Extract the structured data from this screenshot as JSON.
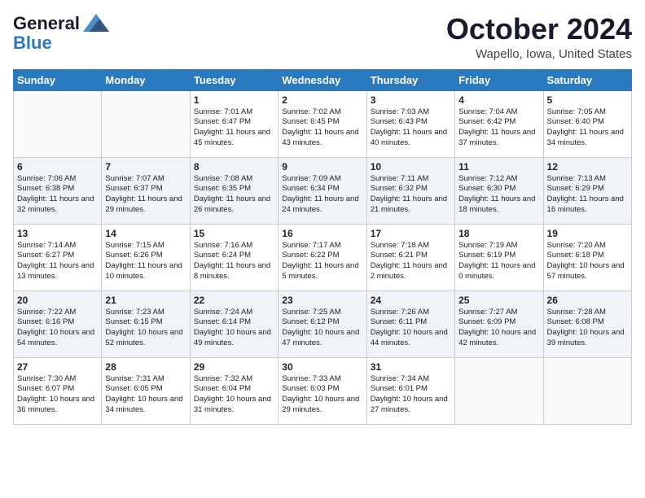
{
  "header": {
    "logo_general": "General",
    "logo_blue": "Blue",
    "month_title": "October 2024",
    "location": "Wapello, Iowa, United States"
  },
  "days_of_week": [
    "Sunday",
    "Monday",
    "Tuesday",
    "Wednesday",
    "Thursday",
    "Friday",
    "Saturday"
  ],
  "weeks": [
    [
      {
        "day": "",
        "info": ""
      },
      {
        "day": "",
        "info": ""
      },
      {
        "day": "1",
        "info": "Sunrise: 7:01 AM\nSunset: 6:47 PM\nDaylight: 11 hours and 45 minutes."
      },
      {
        "day": "2",
        "info": "Sunrise: 7:02 AM\nSunset: 6:45 PM\nDaylight: 11 hours and 43 minutes."
      },
      {
        "day": "3",
        "info": "Sunrise: 7:03 AM\nSunset: 6:43 PM\nDaylight: 11 hours and 40 minutes."
      },
      {
        "day": "4",
        "info": "Sunrise: 7:04 AM\nSunset: 6:42 PM\nDaylight: 11 hours and 37 minutes."
      },
      {
        "day": "5",
        "info": "Sunrise: 7:05 AM\nSunset: 6:40 PM\nDaylight: 11 hours and 34 minutes."
      }
    ],
    [
      {
        "day": "6",
        "info": "Sunrise: 7:06 AM\nSunset: 6:38 PM\nDaylight: 11 hours and 32 minutes."
      },
      {
        "day": "7",
        "info": "Sunrise: 7:07 AM\nSunset: 6:37 PM\nDaylight: 11 hours and 29 minutes."
      },
      {
        "day": "8",
        "info": "Sunrise: 7:08 AM\nSunset: 6:35 PM\nDaylight: 11 hours and 26 minutes."
      },
      {
        "day": "9",
        "info": "Sunrise: 7:09 AM\nSunset: 6:34 PM\nDaylight: 11 hours and 24 minutes."
      },
      {
        "day": "10",
        "info": "Sunrise: 7:11 AM\nSunset: 6:32 PM\nDaylight: 11 hours and 21 minutes."
      },
      {
        "day": "11",
        "info": "Sunrise: 7:12 AM\nSunset: 6:30 PM\nDaylight: 11 hours and 18 minutes."
      },
      {
        "day": "12",
        "info": "Sunrise: 7:13 AM\nSunset: 6:29 PM\nDaylight: 11 hours and 16 minutes."
      }
    ],
    [
      {
        "day": "13",
        "info": "Sunrise: 7:14 AM\nSunset: 6:27 PM\nDaylight: 11 hours and 13 minutes."
      },
      {
        "day": "14",
        "info": "Sunrise: 7:15 AM\nSunset: 6:26 PM\nDaylight: 11 hours and 10 minutes."
      },
      {
        "day": "15",
        "info": "Sunrise: 7:16 AM\nSunset: 6:24 PM\nDaylight: 11 hours and 8 minutes."
      },
      {
        "day": "16",
        "info": "Sunrise: 7:17 AM\nSunset: 6:22 PM\nDaylight: 11 hours and 5 minutes."
      },
      {
        "day": "17",
        "info": "Sunrise: 7:18 AM\nSunset: 6:21 PM\nDaylight: 11 hours and 2 minutes."
      },
      {
        "day": "18",
        "info": "Sunrise: 7:19 AM\nSunset: 6:19 PM\nDaylight: 11 hours and 0 minutes."
      },
      {
        "day": "19",
        "info": "Sunrise: 7:20 AM\nSunset: 6:18 PM\nDaylight: 10 hours and 57 minutes."
      }
    ],
    [
      {
        "day": "20",
        "info": "Sunrise: 7:22 AM\nSunset: 6:16 PM\nDaylight: 10 hours and 54 minutes."
      },
      {
        "day": "21",
        "info": "Sunrise: 7:23 AM\nSunset: 6:15 PM\nDaylight: 10 hours and 52 minutes."
      },
      {
        "day": "22",
        "info": "Sunrise: 7:24 AM\nSunset: 6:14 PM\nDaylight: 10 hours and 49 minutes."
      },
      {
        "day": "23",
        "info": "Sunrise: 7:25 AM\nSunset: 6:12 PM\nDaylight: 10 hours and 47 minutes."
      },
      {
        "day": "24",
        "info": "Sunrise: 7:26 AM\nSunset: 6:11 PM\nDaylight: 10 hours and 44 minutes."
      },
      {
        "day": "25",
        "info": "Sunrise: 7:27 AM\nSunset: 6:09 PM\nDaylight: 10 hours and 42 minutes."
      },
      {
        "day": "26",
        "info": "Sunrise: 7:28 AM\nSunset: 6:08 PM\nDaylight: 10 hours and 39 minutes."
      }
    ],
    [
      {
        "day": "27",
        "info": "Sunrise: 7:30 AM\nSunset: 6:07 PM\nDaylight: 10 hours and 36 minutes."
      },
      {
        "day": "28",
        "info": "Sunrise: 7:31 AM\nSunset: 6:05 PM\nDaylight: 10 hours and 34 minutes."
      },
      {
        "day": "29",
        "info": "Sunrise: 7:32 AM\nSunset: 6:04 PM\nDaylight: 10 hours and 31 minutes."
      },
      {
        "day": "30",
        "info": "Sunrise: 7:33 AM\nSunset: 6:03 PM\nDaylight: 10 hours and 29 minutes."
      },
      {
        "day": "31",
        "info": "Sunrise: 7:34 AM\nSunset: 6:01 PM\nDaylight: 10 hours and 27 minutes."
      },
      {
        "day": "",
        "info": ""
      },
      {
        "day": "",
        "info": ""
      }
    ]
  ]
}
